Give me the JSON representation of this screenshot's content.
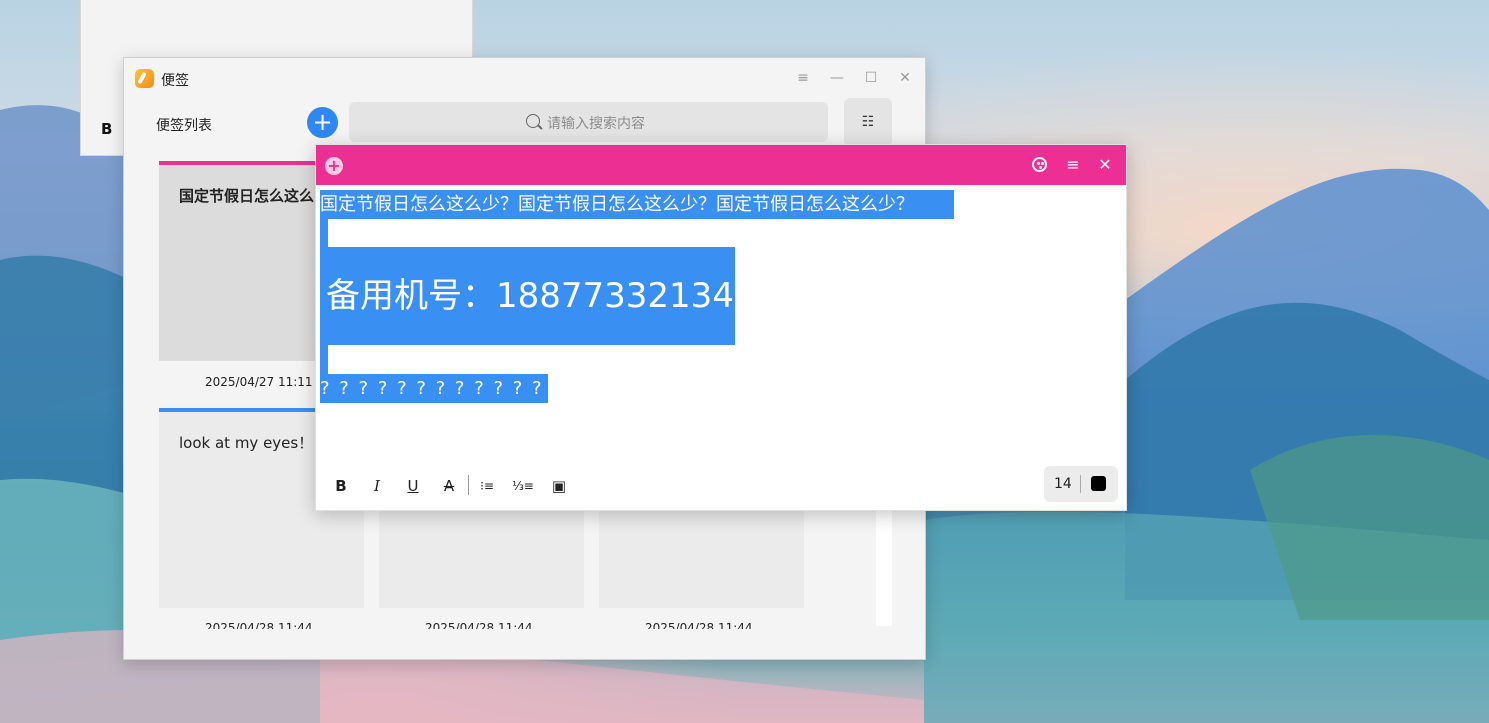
{
  "background_window": {
    "letter": "B"
  },
  "app": {
    "title": "便签",
    "list_title": "便签列表",
    "add_label": "+",
    "search_placeholder": "请输入搜索内容",
    "view_label": "☷",
    "window_controls": {
      "menu": "≡",
      "minimize": "—",
      "maximize": "☐",
      "close": "✕"
    }
  },
  "cards": [
    {
      "text": "国定节假日怎么这么",
      "date": "2025/04/27  11:11",
      "bar_color": "#ec2f93"
    },
    {
      "text": "look at my eyes！！",
      "date": "2025/04/28  11:44",
      "bar_color": "#3a8ff3"
    },
    {
      "text": "",
      "date": "2025/04/28  11:44"
    },
    {
      "text": "",
      "date": "2025/04/28  11:44"
    }
  ],
  "note": {
    "header_color": "#ec2f93",
    "add_label": "+",
    "menu_label": "≡",
    "close_label": "✕",
    "line1": "国定节假日怎么这么少？国定节假日怎么这么少？国定节假日怎么这么少？",
    "line2": "备用机号：18877332134",
    "line3": "? ? ? ? ? ? ? ? ? ? ? ?",
    "selection_color": "#3a8ff3",
    "toolbar": {
      "bold": "B",
      "italic": "I",
      "underline": "U",
      "strike": "A",
      "bullet_list": "⁝≡",
      "number_list": "⅓≡",
      "image": "▣"
    },
    "font_size": "14",
    "text_color": "#000000"
  }
}
